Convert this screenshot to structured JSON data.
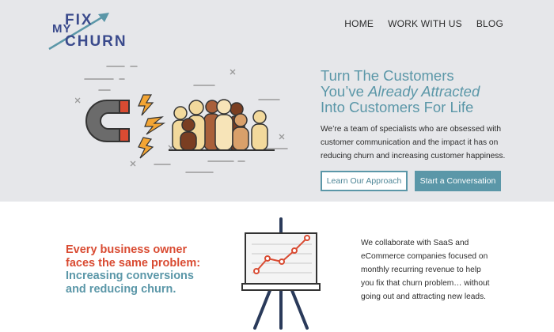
{
  "header": {
    "logo": {
      "line1": "FIX",
      "line2": "MY",
      "line3": "CHURN"
    },
    "nav": [
      {
        "label": "HOME"
      },
      {
        "label": "WORK WITH US"
      },
      {
        "label": "BLOG"
      }
    ]
  },
  "hero": {
    "title_line1": "Turn The Customers",
    "title_line2_pre": "You’ve ",
    "title_line2_em": "Already Attracted",
    "title_line3": "Into Customers For Life",
    "body": "We’re a team of specialists who are obsessed with customer communication and the impact it has on reducing churn and increasing customer happiness.",
    "btn_primary": "Learn Our Approach",
    "btn_secondary": "Start a Conversation"
  },
  "colors": {
    "accent_teal": "#5b97a8",
    "accent_red": "#d94b32",
    "logo_blue": "#3a4a8c",
    "hero_bg": "#e6e7ea"
  },
  "problem": {
    "line_red": "Every business owner faces the same problem:",
    "line_blue": "Increasing conversions and reducing churn."
  },
  "collab": {
    "body": "We collaborate with SaaS and eCommerce companies focused on monthly recurring revenue to help you fix that churn problem… without going out and attracting new leads."
  },
  "illustrations": {
    "hero": "magnet-attracting-customers-illustration",
    "chart": "easel-growth-chart-illustration"
  }
}
